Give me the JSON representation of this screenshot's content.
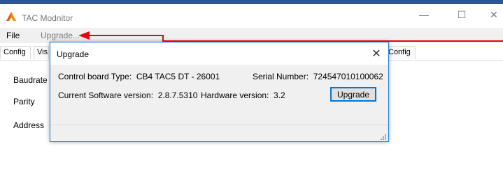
{
  "window": {
    "title": "TAC Modnitor",
    "minimize_glyph": "—",
    "maximize_glyph": "☐",
    "close_glyph": "✕",
    "icon": "tac-logo-icon",
    "accent_color": "#2b579a"
  },
  "menu": {
    "items": [
      {
        "label": "File",
        "state": "normal"
      },
      {
        "label": "Upgrade...",
        "state": "highlighted"
      }
    ]
  },
  "annotation": {
    "arrow_color": "#e8000b",
    "points_to": "Upgrade..."
  },
  "tabs": [
    {
      "label": "Config",
      "selected": true
    },
    {
      "label": "Vis",
      "selected": false
    },
    {
      "label": "Config",
      "selected": false
    }
  ],
  "fields": {
    "baudrate": "Baudrate",
    "parity": "Parity",
    "address": "Address"
  },
  "dialog": {
    "title": "Upgrade",
    "close_glyph": "✕",
    "board_type_label": "Control board Type:",
    "board_type_value": "CB4 TAC5 DT - 26001",
    "serial_label": "Serial Number:",
    "serial_value": "724547010100062",
    "software_label": "Current Software version:",
    "software_value": "2.8.7.5310",
    "hardware_label": "Hardware version:",
    "hardware_value": "3.2",
    "upgrade_button": "Upgrade",
    "border_color": "#1c7fd6"
  }
}
